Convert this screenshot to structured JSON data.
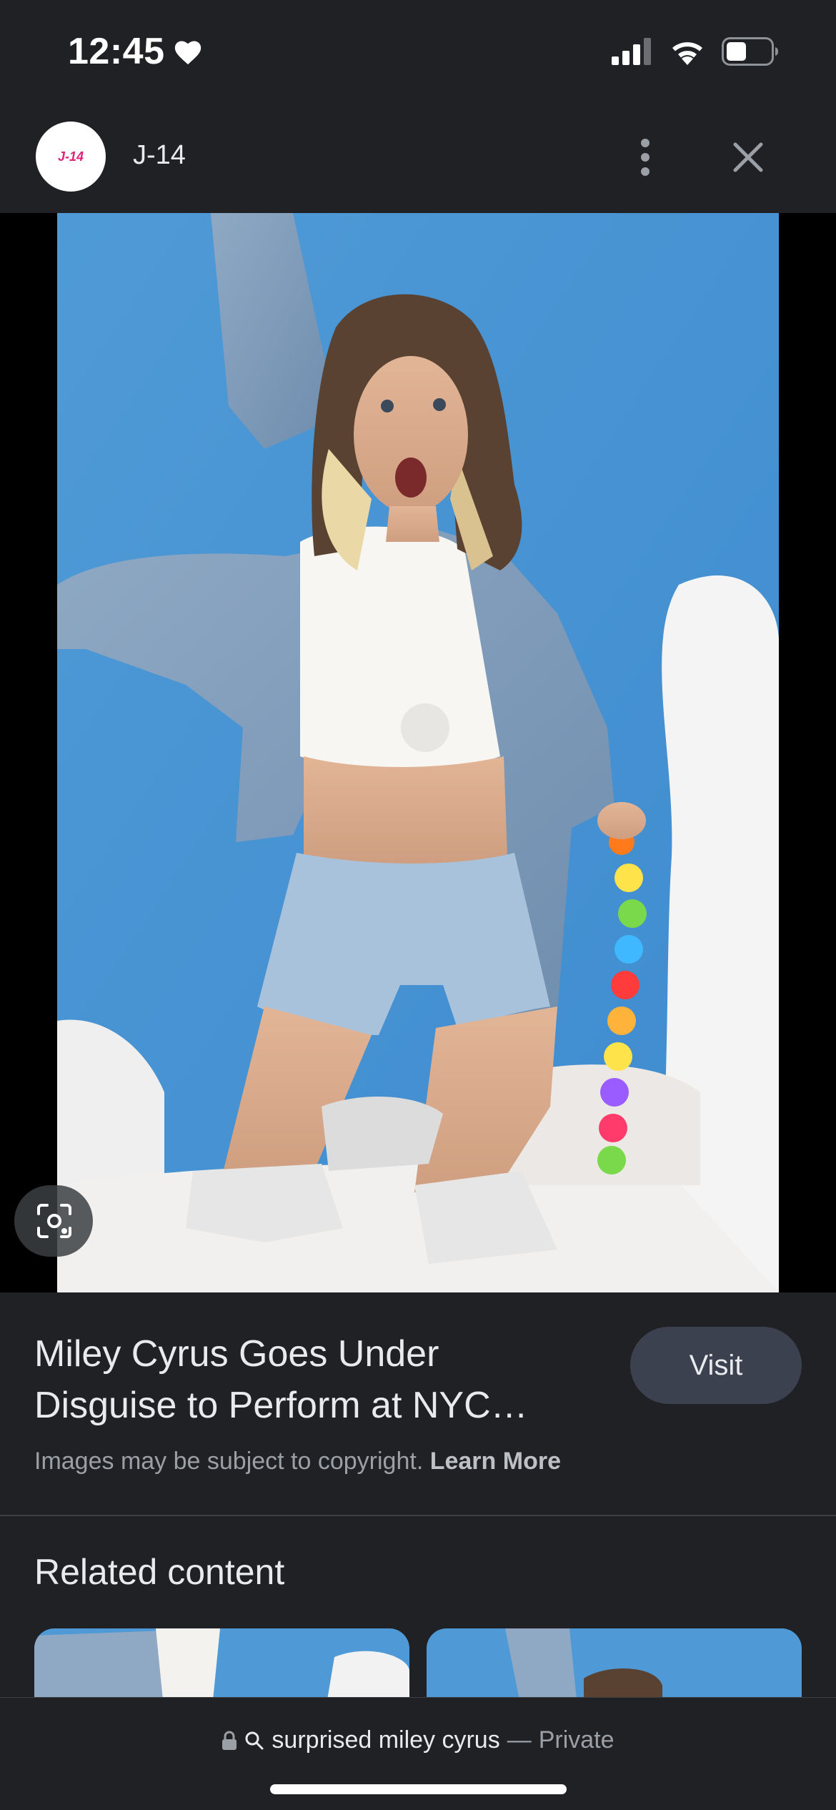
{
  "status_bar": {
    "time": "12:45",
    "icons": [
      "heart-icon",
      "cellular-signal-icon",
      "wifi-icon",
      "battery-icon"
    ],
    "battery_level": 0.45
  },
  "header": {
    "source_logo_text": "J-14",
    "source_name": "J-14",
    "icons": [
      "more-vert-icon",
      "close-icon"
    ]
  },
  "image": {
    "lens_icon": "google-lens-icon",
    "background_color": "#5ba3d8"
  },
  "result": {
    "title": "Miley Cyrus Goes Under Disguise to Perform at NYC…",
    "visit_label": "Visit",
    "copyright_text": "Images may be subject to copyright.",
    "learn_more_label": "Learn More"
  },
  "related": {
    "heading": "Related content"
  },
  "bottom_bar": {
    "query": "surprised miley cyrus",
    "separator": "—",
    "mode": "Private",
    "icons": [
      "lock-icon",
      "search-icon"
    ]
  }
}
